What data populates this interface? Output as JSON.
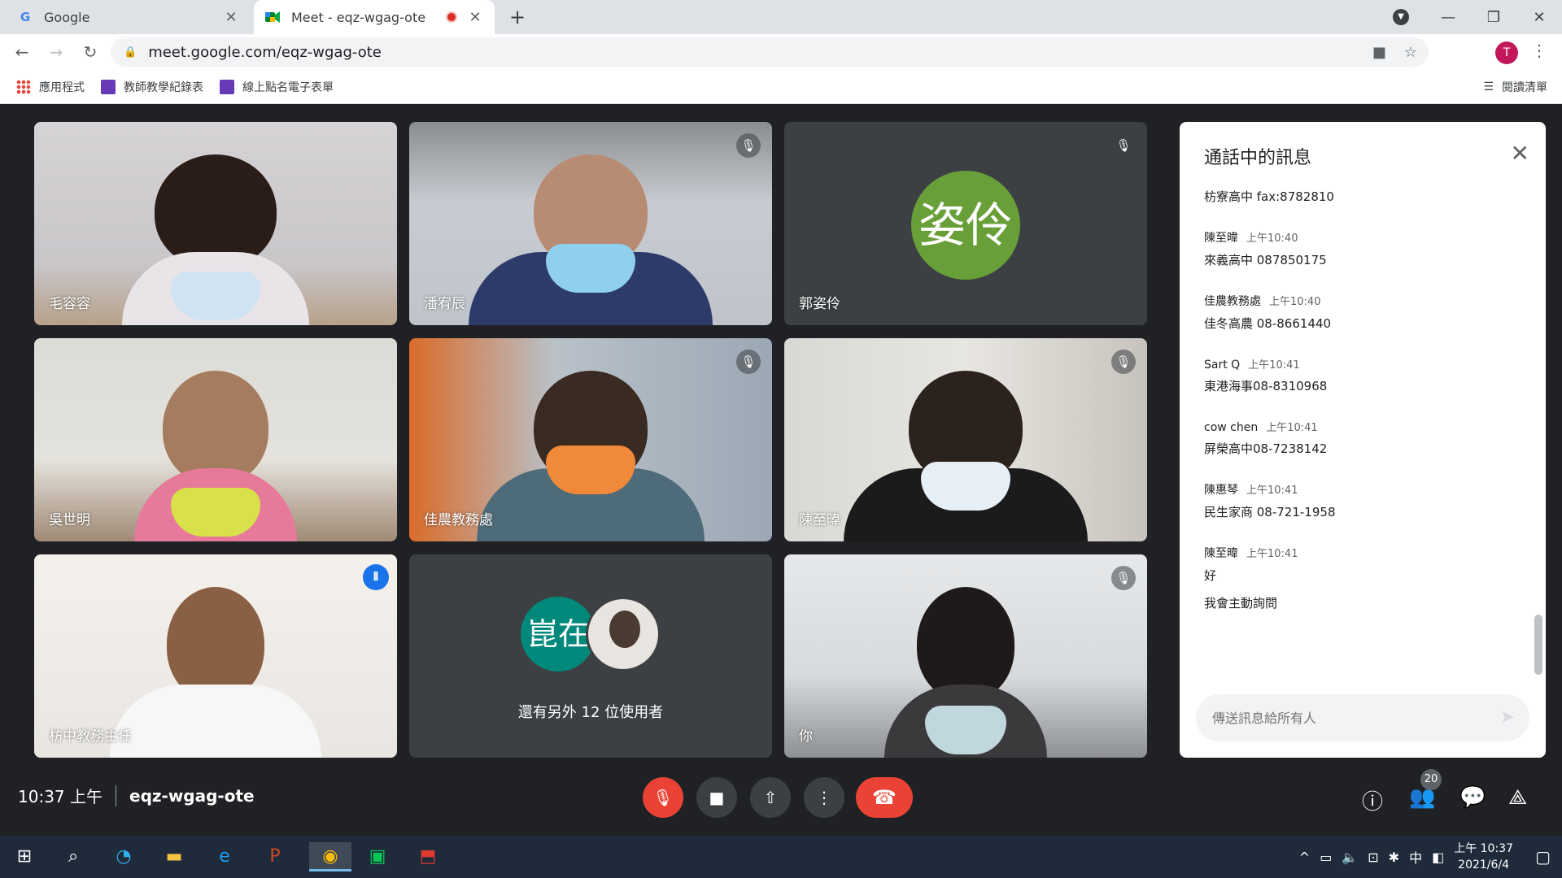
{
  "browser": {
    "tabs": [
      {
        "title": "Google",
        "favicon": "G"
      },
      {
        "title": "Meet - eqz-wgag-ote"
      }
    ],
    "url": "meet.google.com/eqz-wgag-ote",
    "profile_initial": "T",
    "bookmarks": [
      {
        "label": "應用程式"
      },
      {
        "label": "教師教學紀錄表"
      },
      {
        "label": "線上點名電子表單"
      }
    ],
    "reading_list": "閱讀清單"
  },
  "meet": {
    "tiles": [
      {
        "name": "毛容容"
      },
      {
        "name": "潘宥辰"
      },
      {
        "name": "郭姿伶",
        "initials": "姿伶"
      },
      {
        "name": "吳世明"
      },
      {
        "name": "佳農教務處"
      },
      {
        "name": "陳至暐"
      },
      {
        "name": "枋中教務主任"
      },
      {
        "more_text": "還有另外 12 位使用者",
        "initials": "崑在"
      },
      {
        "name": "你"
      }
    ],
    "time": "10:37 上午",
    "meeting_code": "eqz-wgag-ote",
    "participant_count": "20"
  },
  "chat": {
    "title": "通話中的訊息",
    "messages": [
      {
        "sender": "",
        "time": "",
        "text": "枋寮高中 fax:8782810"
      },
      {
        "sender": "陳至暐",
        "time": "上午10:40",
        "text": "來義高中 087850175"
      },
      {
        "sender": "佳農教務處",
        "time": "上午10:40",
        "text": "佳冬高農 08-8661440"
      },
      {
        "sender": "Sart Q",
        "time": "上午10:41",
        "text": "東港海事08-8310968"
      },
      {
        "sender": "cow chen",
        "time": "上午10:41",
        "text": "屏榮高中08-7238142"
      },
      {
        "sender": "陳惠琴",
        "time": "上午10:41",
        "text": "民生家商 08-721-1958"
      },
      {
        "sender": "陳至暐",
        "time": "上午10:41",
        "text": "好"
      },
      {
        "sender": "",
        "time": "",
        "text": "我會主動詢問"
      }
    ],
    "input_placeholder": "傳送訊息給所有人"
  },
  "taskbar": {
    "clock_time": "上午 10:37",
    "clock_date": "2021/6/4",
    "ime": "中"
  }
}
